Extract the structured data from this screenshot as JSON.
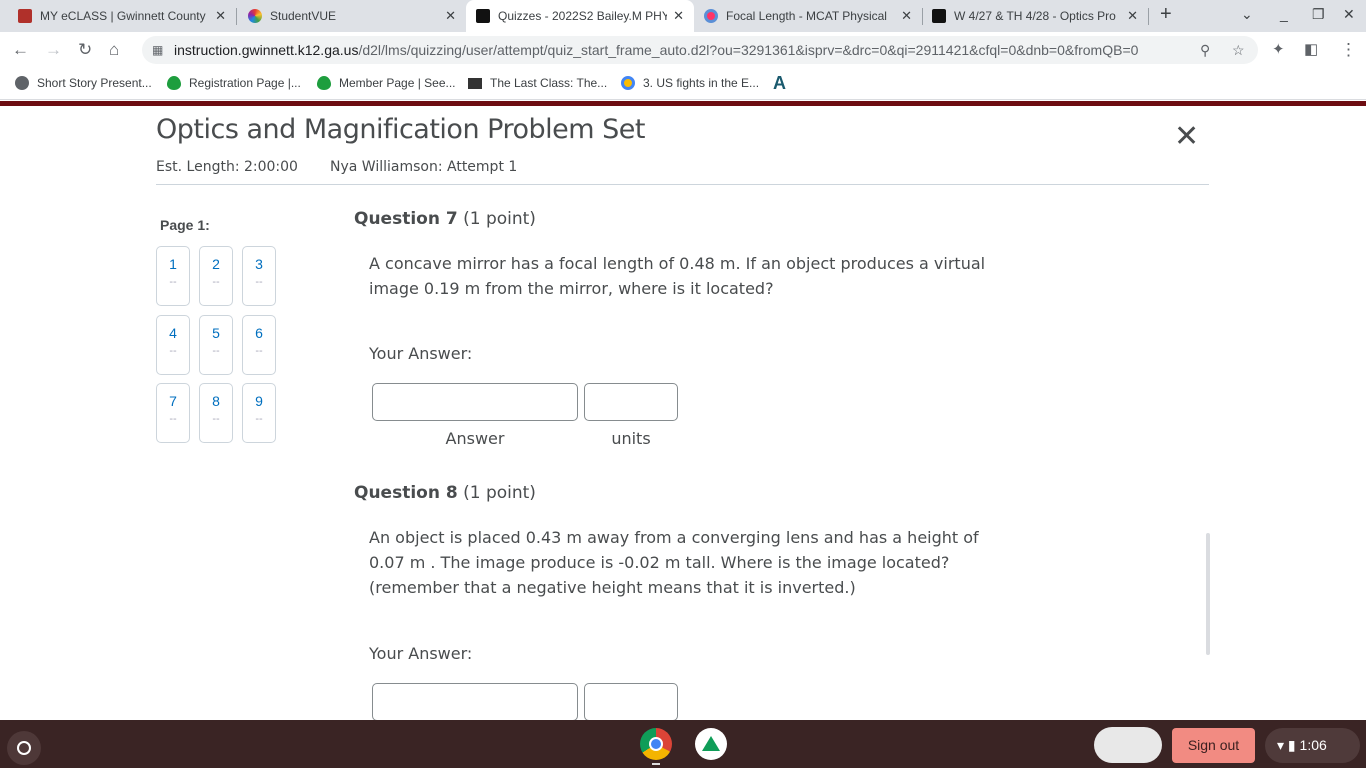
{
  "browser": {
    "tabs": [
      {
        "title": "MY eCLASS | Gwinnett County",
        "icon": "eclass-icon",
        "active": false
      },
      {
        "title": "StudentVUE",
        "icon": "studentvue-icon",
        "active": false
      },
      {
        "title": "Quizzes - 2022S2 Bailey.M PHY",
        "icon": "d2l-icon",
        "active": true
      },
      {
        "title": "Focal Length - MCAT Physical",
        "icon": "focal-icon",
        "active": false
      },
      {
        "title": "W 4/27 & TH 4/28 - Optics Pro",
        "icon": "d2l-icon",
        "active": false
      }
    ],
    "new_tab": "+",
    "url_host": "instruction.gwinnett.k12.ga.us",
    "url_path": "/d2l/lms/quizzing/user/attempt/quiz_start_frame_auto.d2l?ou=3291361&isprv=&drc=0&qi=2911421&cfql=0&dnb=0&fromQB=0",
    "bookmarks": [
      {
        "label": "Short Story Present...",
        "icon": "globe-icon"
      },
      {
        "label": "Registration Page |...",
        "icon": "leaf-icon"
      },
      {
        "label": "Member Page | See...",
        "icon": "leaf-icon"
      },
      {
        "label": "The Last Class: The...",
        "icon": "book-icon"
      },
      {
        "label": "3. US fights in the E...",
        "icon": "compass-icon"
      },
      {
        "label": "",
        "icon": "a-logo-icon"
      }
    ]
  },
  "quiz": {
    "title": "Optics and Magnification Problem Set",
    "est_length": "Est. Length: 2:00:00",
    "attempt": "Nya Williamson: Attempt 1",
    "page_label": "Page 1:",
    "question_buttons": [
      {
        "num": "1",
        "status": "--"
      },
      {
        "num": "2",
        "status": "--"
      },
      {
        "num": "3",
        "status": "--"
      },
      {
        "num": "4",
        "status": "--"
      },
      {
        "num": "5",
        "status": "--"
      },
      {
        "num": "6",
        "status": "--"
      },
      {
        "num": "7",
        "status": "--"
      },
      {
        "num": "8",
        "status": "--"
      },
      {
        "num": "9",
        "status": "--"
      }
    ],
    "questions": [
      {
        "title": "Question 7",
        "points": "(1 point)",
        "text": "A concave mirror has a focal length of 0.48 m.  If an object produces a virtual image 0.19 m from the mirror,  where is it located?",
        "answer_label": "Your Answer:",
        "answer_value": "",
        "units_value": "",
        "answer_caption": "Answer",
        "units_caption": "units"
      },
      {
        "title": "Question 8",
        "points": "(1 point)",
        "text": "An object is placed 0.43 m away from a converging lens and has a height of 0.07 m . The image produce is  -0.02 m tall.  Where is the image located? (remember that a negative height means that it is inverted.)",
        "answer_label": "Your Answer:",
        "answer_value": "",
        "units_value": ""
      }
    ]
  },
  "shelf": {
    "sign_out": "Sign out",
    "time": "1:06"
  },
  "colors": {
    "accent": "#6d0d12",
    "link": "#006fbf",
    "signout": "#f28b82"
  }
}
